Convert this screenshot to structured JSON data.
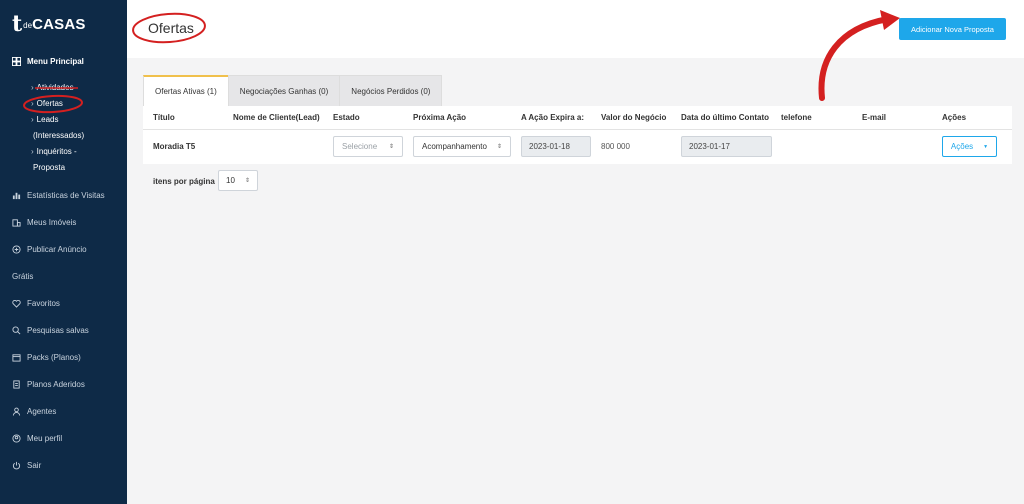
{
  "brand": {
    "mark": "t",
    "de": "de",
    "casas": "CASAS"
  },
  "sidebar": {
    "menu_principal": "Menu Principal",
    "sub_items": [
      {
        "label": "Atividades"
      },
      {
        "label": "Ofertas"
      },
      {
        "label": "Leads"
      },
      {
        "label": "(Interessados)"
      },
      {
        "label": "Inquéritos -"
      },
      {
        "label": "Proposta"
      }
    ],
    "items": [
      {
        "label": "Estatísticas de Visitas",
        "icon": "bar-chart-icon"
      },
      {
        "label": "Meus Imóveis",
        "icon": "building-icon"
      },
      {
        "label": "Publicar Anúncio",
        "icon": "plus-circle-icon"
      },
      {
        "label": "Grátis",
        "icon": ""
      },
      {
        "label": "Favoritos",
        "icon": "heart-icon"
      },
      {
        "label": "Pesquisas salvas",
        "icon": "search-icon"
      },
      {
        "label": "Packs (Planos)",
        "icon": "box-icon"
      },
      {
        "label": "Planos Aderidos",
        "icon": "document-icon"
      },
      {
        "label": "Agentes",
        "icon": "user-icon"
      },
      {
        "label": "Meu perfil",
        "icon": "profile-icon"
      },
      {
        "label": "Sair",
        "icon": "power-icon"
      }
    ]
  },
  "header": {
    "title": "Ofertas",
    "add_button": "Adicionar Nova Proposta"
  },
  "tabs": [
    {
      "label": "Ofertas Ativas (1)",
      "active": true
    },
    {
      "label": "Negociações Ganhas (0)",
      "active": false
    },
    {
      "label": "Negócios Perdidos (0)",
      "active": false
    }
  ],
  "table": {
    "headers": [
      "Título",
      "Nome de Cliente(Lead)",
      "Estado",
      "Próxima Ação",
      "A Ação Expira a:",
      "Valor do Negócio",
      "Data do último Contato",
      "telefone",
      "E-mail",
      "Ações"
    ],
    "row": {
      "titulo": "Moradia T5",
      "nome": "",
      "estado_placeholder": "Selecione",
      "proxima_acao": "Acompanhamento",
      "expira": "2023-01-18",
      "valor": "800 000",
      "ultimo_contato": "2023-01-17",
      "telefone": "",
      "email": "",
      "acoes": "Ações"
    }
  },
  "pagination": {
    "label": "itens por página",
    "value": "10"
  },
  "colors": {
    "sidebar": "#0e2a47",
    "accent": "#1ea7ea",
    "annotation": "#d42020",
    "tab_active_border": "#f0c04c"
  }
}
